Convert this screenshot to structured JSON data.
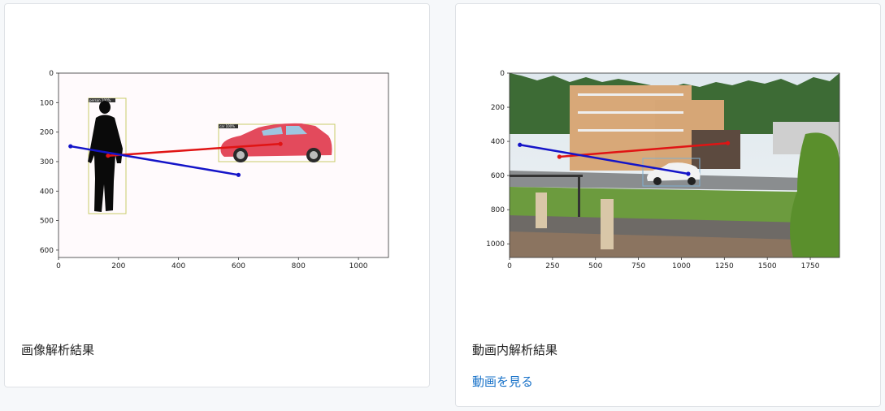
{
  "cards": [
    {
      "title": "画像解析結果",
      "chart_data": {
        "type": "image",
        "xlim": [
          0,
          1100
        ],
        "ylim": [
          625,
          0
        ],
        "xticks": [
          "0",
          "200",
          "400",
          "600",
          "800",
          "1000"
        ],
        "yticks": [
          "0",
          "100",
          "200",
          "300",
          "400",
          "500",
          "600"
        ],
        "detections": [
          {
            "label": "person 100%",
            "color": "#c8cc6a"
          },
          {
            "label": "car 100%",
            "color": "#c8cc6a"
          }
        ],
        "lines": [
          {
            "color": "#e01414",
            "from": [
              165,
              280
            ],
            "to": [
              740,
              240
            ]
          },
          {
            "color": "#1414c8",
            "from": [
              40,
              248
            ],
            "to": [
              600,
              345
            ]
          }
        ]
      }
    },
    {
      "title": "動画内解析結果",
      "link": "動画を見る",
      "chart_data": {
        "type": "image",
        "xlim": [
          0,
          1920
        ],
        "ylim": [
          1080,
          0
        ],
        "xticks": [
          "0",
          "250",
          "500",
          "750",
          "1000",
          "1250",
          "1500",
          "1750"
        ],
        "yticks": [
          "0",
          "200",
          "400",
          "600",
          "800",
          "1000"
        ],
        "lines": [
          {
            "color": "#e01414",
            "from": [
              290,
              490
            ],
            "to": [
              1270,
              410
            ]
          },
          {
            "color": "#1414c8",
            "from": [
              60,
              420
            ],
            "to": [
              1040,
              590
            ]
          }
        ]
      }
    }
  ]
}
